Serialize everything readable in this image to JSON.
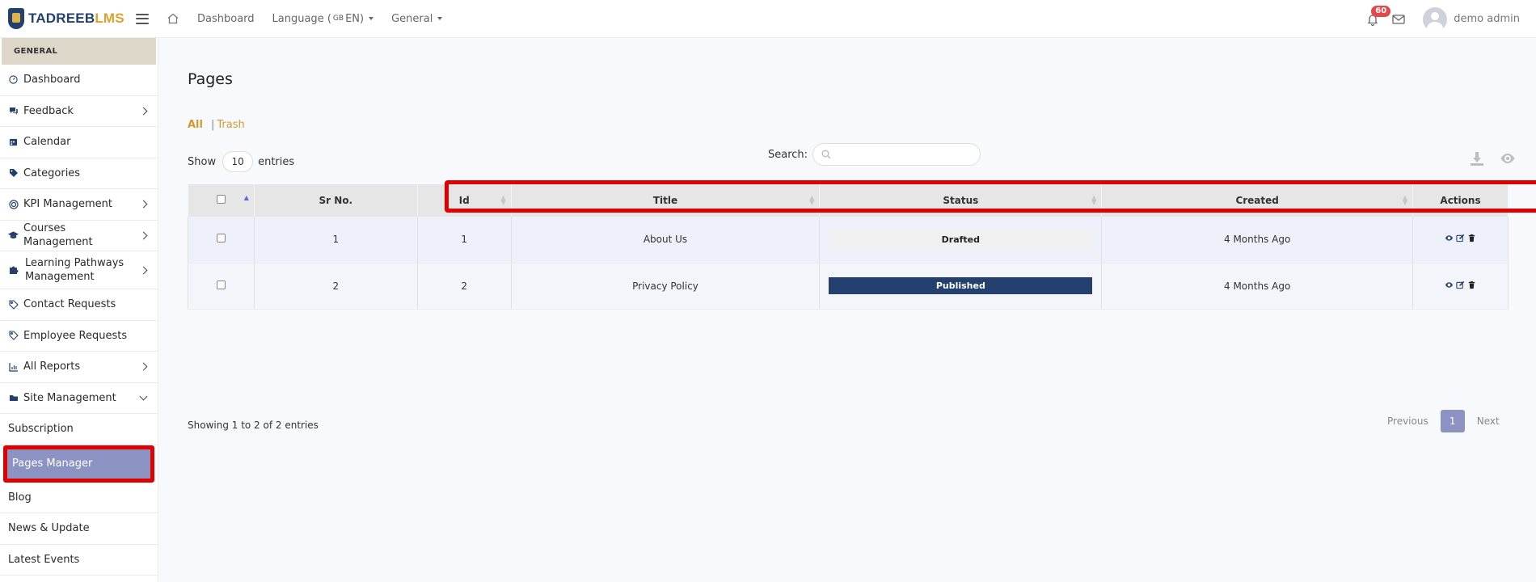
{
  "brand": {
    "part1": "TADREEB",
    "part2": "LMS"
  },
  "topnav": {
    "dashboard": "Dashboard",
    "language_label": "Language (",
    "language_flag": "GB",
    "language_suffix": " EN)",
    "general": "General"
  },
  "notifications": {
    "count": "60"
  },
  "user": {
    "name": "demo admin"
  },
  "sidebar": {
    "section": "GENERAL",
    "items": [
      {
        "label": "Dashboard",
        "icon": "dashboard-icon"
      },
      {
        "label": "Feedback",
        "icon": "comments-icon"
      },
      {
        "label": "Calendar",
        "icon": "calendar-icon"
      },
      {
        "label": "Categories",
        "icon": "tags-icon"
      },
      {
        "label": "KPI Management",
        "icon": "target-icon"
      },
      {
        "label": "Courses Management",
        "icon": "graduation-cap-icon"
      },
      {
        "label": "Learning Pathways Management",
        "icon": "puzzle-icon"
      },
      {
        "label": "Contact Requests",
        "icon": "tag-icon"
      },
      {
        "label": "Employee Requests",
        "icon": "tag-icon"
      },
      {
        "label": "All Reports",
        "icon": "chart-icon"
      },
      {
        "label": "Site Management",
        "icon": "folder-icon"
      }
    ],
    "subitems": [
      "Subscription",
      "Pages Manager",
      "Blog",
      "News & Update",
      "Latest Events"
    ]
  },
  "page": {
    "title": "Pages",
    "filter_all": "All",
    "filter_sep": "|",
    "filter_trash": "Trash",
    "show_label": "Show",
    "show_value": "10",
    "entries_label": "entries",
    "search_label": "Search:"
  },
  "table": {
    "columns": [
      "Sr No.",
      "Id",
      "Title",
      "Status",
      "Created",
      "Actions"
    ],
    "rows": [
      {
        "sr": "1",
        "id": "1",
        "title": "About Us",
        "status": "Drafted",
        "created": "4 Months Ago"
      },
      {
        "sr": "2",
        "id": "2",
        "title": "Privacy Policy",
        "status": "Published",
        "created": "4 Months Ago"
      }
    ]
  },
  "footer": {
    "showing": "Showing 1 to 2 of 2 entries",
    "previous": "Previous",
    "page": "1",
    "next": "Next"
  },
  "colors": {
    "primary": "#23406f",
    "accent": "#e0a030",
    "active": "#8c93c2",
    "highlight": "#e00000"
  }
}
